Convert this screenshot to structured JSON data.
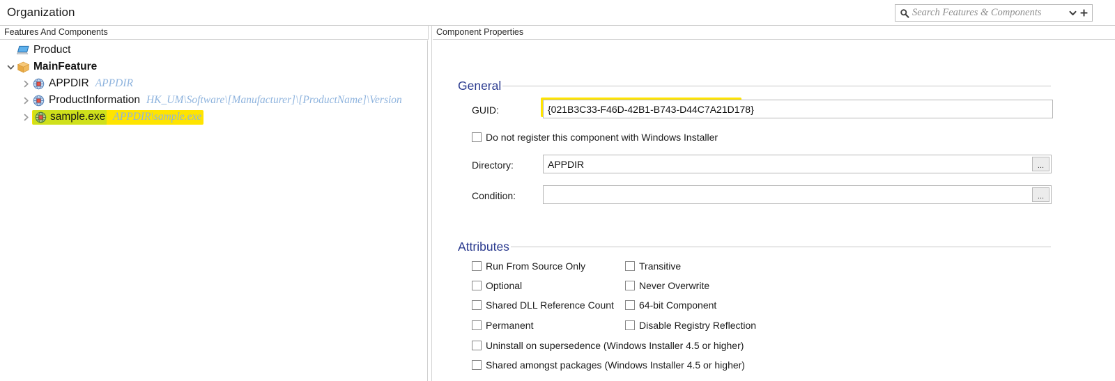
{
  "window": {
    "title": "Organization"
  },
  "search": {
    "placeholder": "Search Features & Components",
    "icon": "search-icon",
    "dropdown_icon": "chevron-down-icon",
    "add_icon": "plus-icon"
  },
  "left_pane": {
    "header": "Features And Components",
    "tree": [
      {
        "label": "Product",
        "path": "",
        "icon": "monitor-icon",
        "level": 0,
        "expander": "none",
        "bold": false,
        "highlight": "none"
      },
      {
        "label": "MainFeature",
        "path": "",
        "icon": "feature-box-icon",
        "level": 1,
        "expander": "expanded",
        "bold": true,
        "highlight": "none"
      },
      {
        "label": "APPDIR",
        "path": "APPDIR",
        "icon": "component-globe-icon",
        "level": 2,
        "expander": "collapsed",
        "bold": false,
        "highlight": "none"
      },
      {
        "label": "ProductInformation",
        "path": "HK_UM\\Software\\[Manufacturer]\\[ProductName]\\Version",
        "icon": "component-globe-icon",
        "level": 2,
        "expander": "collapsed",
        "bold": false,
        "highlight": "none"
      },
      {
        "label": "sample.exe",
        "path": "APPDIR\\sample.exe",
        "icon": "component-globe-icon",
        "level": 2,
        "expander": "collapsed",
        "bold": false,
        "highlight": "marker"
      }
    ]
  },
  "right_pane": {
    "header": "Component Properties",
    "general": {
      "title": "General",
      "guid_label": "GUID:",
      "guid_value": "{021B3C33-F46D-42B1-B743-D44C7A21D178}",
      "guid_highlighted": true,
      "no_register_label": "Do not register this component with Windows Installer",
      "no_register_checked": false,
      "directory_label": "Directory:",
      "directory_value": "APPDIR",
      "directory_browse": "...",
      "condition_label": "Condition:",
      "condition_value": "",
      "condition_browse": "..."
    },
    "attributes": {
      "title": "Attributes",
      "column_left": [
        {
          "label": "Run From Source Only",
          "checked": false
        },
        {
          "label": "Optional",
          "checked": false
        },
        {
          "label": "Shared DLL Reference Count",
          "checked": false
        },
        {
          "label": "Permanent",
          "checked": false
        }
      ],
      "column_right": [
        {
          "label": "Transitive",
          "checked": false
        },
        {
          "label": "Never Overwrite",
          "checked": false
        },
        {
          "label": "64-bit Component",
          "checked": false
        },
        {
          "label": "Disable Registry Reflection",
          "checked": false
        }
      ],
      "full_width": [
        {
          "label": "Uninstall on supersedence (Windows Installer 4.5 or higher)",
          "checked": false
        },
        {
          "label": "Shared amongst packages (Windows Installer 4.5 or higher)",
          "checked": false
        }
      ]
    }
  },
  "colors": {
    "group_title": "#2b3b8f",
    "tree_path": "#8fb4de",
    "marker_yellow": "#ffe400",
    "marker_green": "#cfe01b"
  }
}
